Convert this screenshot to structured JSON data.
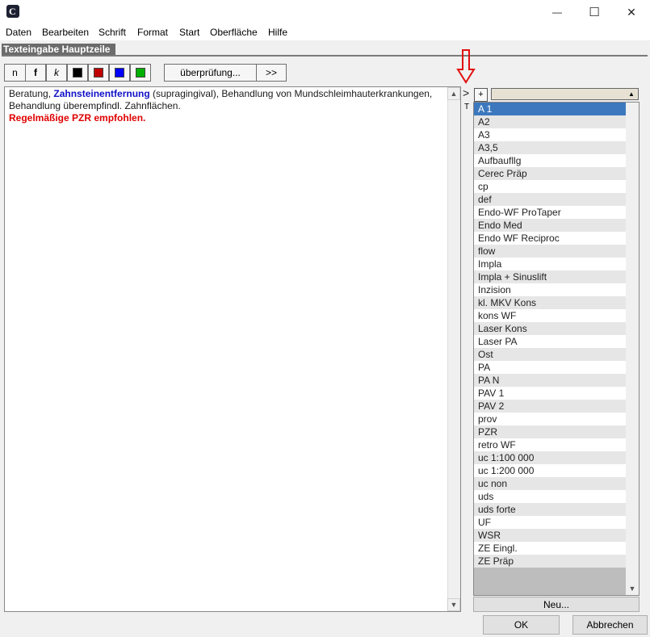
{
  "window": {
    "app_icon_letter": "C",
    "minimize_glyph": "—",
    "maximize_glyph": "☐",
    "close_glyph": "✕"
  },
  "menu": {
    "items": [
      "Daten",
      "Bearbeiten",
      "Schrift",
      "Format",
      "Start",
      "Oberfläche",
      "Hilfe"
    ]
  },
  "section": {
    "label": "Texteingabe Hauptzeile"
  },
  "toolbar": {
    "normal_label": "n",
    "bold_label": "f",
    "italic_label": "k",
    "check_label": "überprüfung...",
    "next_label": ">>",
    "colors": [
      "#000000",
      "#c00000",
      "#0000ff",
      "#00b000"
    ]
  },
  "editor": {
    "segments": [
      "Beratung, ",
      "Zahnsteinentfernung",
      " (supragingival), Behandlung von Mundschleimhauterkrankungen, Behandlung überempfindl. Zahnflächen.",
      "Regelmäßige PZR empfohlen."
    ]
  },
  "markers": {
    "chevron": ">",
    "t_label": "T"
  },
  "side_panel": {
    "plus_label": "+",
    "selected_index": 0,
    "items": [
      "A 1",
      "A2",
      "A3",
      "A3,5",
      "Aufbaufllg",
      "Cerec Präp",
      "cp",
      "def",
      "Endo-WF  ProTaper",
      "Endo Med",
      "Endo WF Reciproc",
      "flow",
      "Impla",
      "Impla + Sinuslift",
      "Inzision",
      "kl. MKV Kons",
      "kons WF",
      "Laser Kons",
      "Laser PA",
      "Ost",
      "PA",
      "PA N",
      "PAV 1",
      "PAV 2",
      "prov",
      "PZR",
      "retro WF",
      "uc 1:100 000",
      "uc 1:200 000",
      "uc non",
      "uds",
      "uds forte",
      "UF",
      "WSR",
      "ZE Eingl.",
      "ZE Präp"
    ],
    "new_label": "Neu..."
  },
  "dialog": {
    "ok_label": "OK",
    "cancel_label": "Abbrechen"
  }
}
